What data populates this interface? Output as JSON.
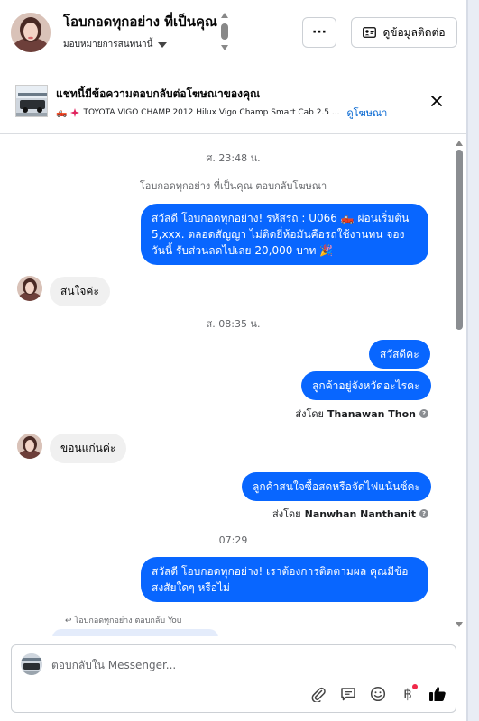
{
  "header": {
    "contact_name": "โอบกอดทุกอย่าง ที่เป็นคุณ",
    "assign_label": "มอบหมายการสนทนานี้",
    "more_label": "···",
    "contact_info_label": "ดูข้อมูลติดต่อ"
  },
  "ad_bar": {
    "title": "แชทนี้มีข้อความตอบกลับต่อโฆษณาของคุณ",
    "ad_text": "TOYOTA VIGO CHAMP 2012 Hilux Vigo Champ Smart Cab 2.5 ...",
    "view_ad_label": "ดูโฆษณา"
  },
  "chat": {
    "timestamp_1": "ศ. 23:48 น.",
    "system_note": "โอบกอดทุกอย่าง ที่เป็นคุณ ตอบกลับโฆษณา",
    "msg_out_1": "สวัสดี โอบกอดทุกอย่าง! รหัสรถ : U066 🛻 ผ่อนเริ่มต้น 5,xxx. ตลอดสัญญา ไม่ติดยี่ห้อมันคือรถใช้งานทน จองวันนี้ รับส่วนลดไปเลย 20,000 บาท 🎉",
    "msg_in_1": "สนใจค่ะ",
    "timestamp_2": "ส. 08:35 น.",
    "msg_out_2": "สวัสดีคะ",
    "msg_out_3": "ลูกค้าอยู่จังหวัดอะไรคะ",
    "sent_by_prefix_1": "ส่งโดย",
    "sent_by_name_1": "Thanawan Thon",
    "msg_in_2": "ขอนแก่นค่ะ",
    "msg_out_4": "ลูกค้าสนใจซื้อสดหรือจัดไฟแน้นซ์คะ",
    "sent_by_prefix_2": "ส่งโดย",
    "sent_by_name_2": "Nanwhan Nanthanit",
    "timestamp_3": "07:29",
    "msg_out_5": "สวัสดี โอบกอดทุกอย่าง! เราต้องการติดตามผล คุณมีข้อสงสัยใดๆ หรือไม่",
    "reply_note": "โอบกอดทุกอย่าง ตอบกลับ You"
  },
  "composer": {
    "placeholder": "ตอบกลับใน Messenger..."
  },
  "colors": {
    "accent": "#0866ff",
    "link": "#0064d1",
    "incoming_bubble": "#f0f0f0",
    "notification_dot": "#f02849"
  },
  "icons": [
    "caret-down-icon",
    "more-icon",
    "contact-card-icon",
    "close-icon",
    "attachment-icon",
    "comment-icon",
    "emoji-icon",
    "baht-icon",
    "like-icon"
  ]
}
